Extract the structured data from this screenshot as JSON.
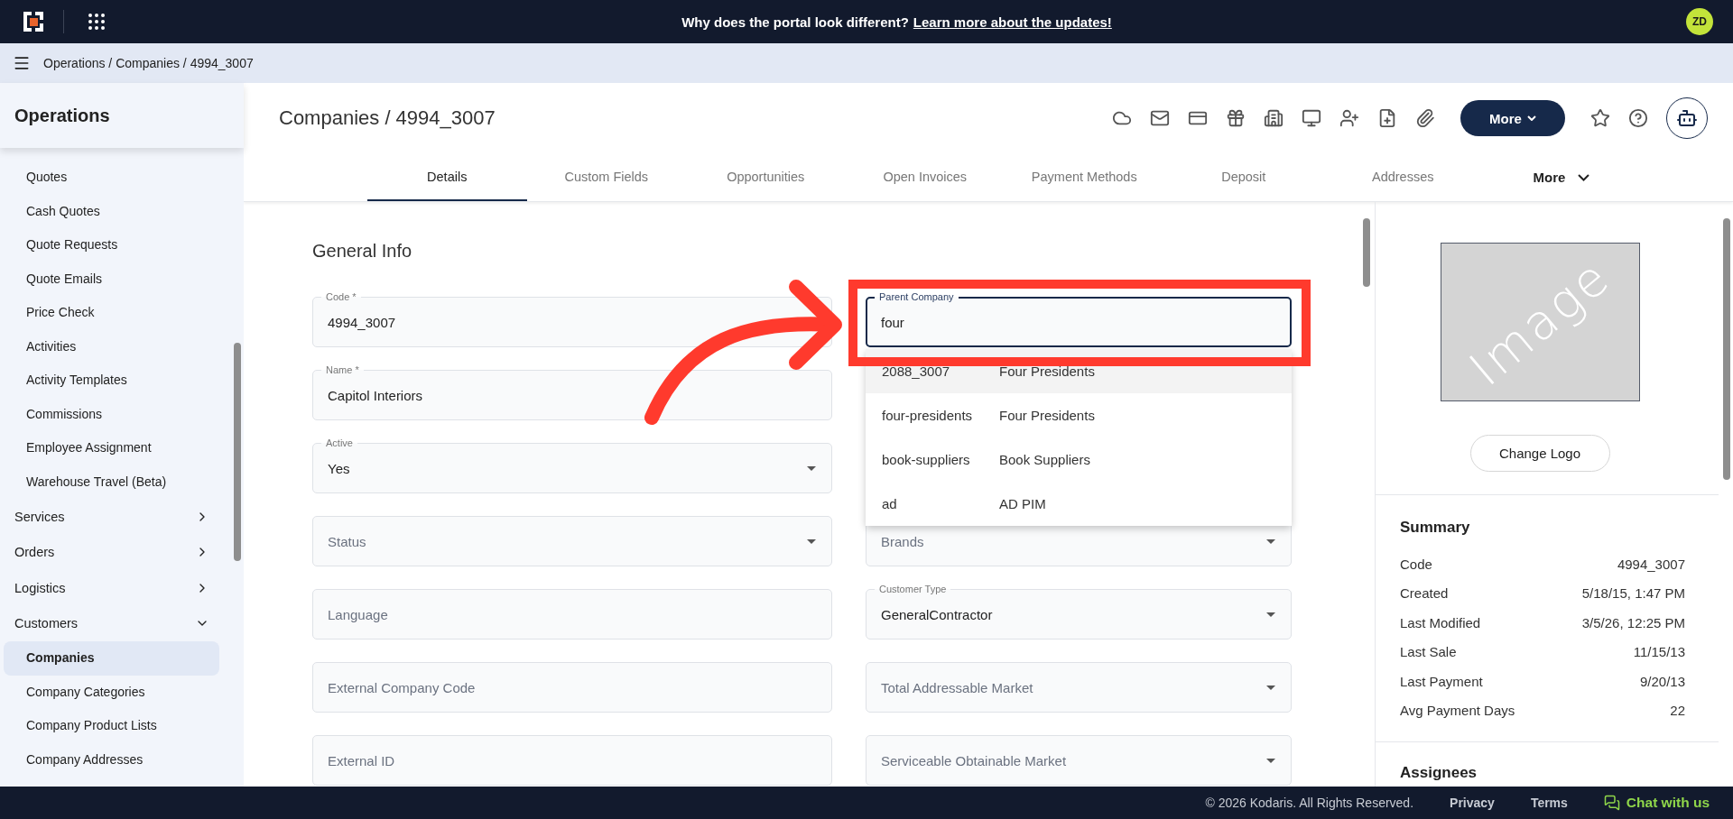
{
  "banner": {
    "text": "Why does the portal look different?",
    "link": "Learn more about the updates!"
  },
  "user": {
    "initials": "ZD"
  },
  "breadcrumb": "Operations / Companies / 4994_3007",
  "sidebar": {
    "title": "Operations",
    "sections": [
      {
        "children": [
          {
            "label": "Quotes",
            "selected": false
          },
          {
            "label": "Cash Quotes",
            "selected": false
          },
          {
            "label": "Quote Requests",
            "selected": false
          },
          {
            "label": "Quote Emails",
            "selected": false
          },
          {
            "label": "Price Check",
            "selected": false
          },
          {
            "label": "Activities",
            "selected": false
          },
          {
            "label": "Activity Templates",
            "selected": false
          },
          {
            "label": "Commissions",
            "selected": false
          },
          {
            "label": "Employee Assignment",
            "selected": false
          },
          {
            "label": "Warehouse Travel (Beta)",
            "selected": false
          }
        ]
      },
      {
        "label": "Services",
        "expanded": false
      },
      {
        "label": "Orders",
        "expanded": false
      },
      {
        "label": "Logistics",
        "expanded": false
      },
      {
        "label": "Customers",
        "expanded": true,
        "children": [
          {
            "label": "Companies",
            "selected": true
          },
          {
            "label": "Company Categories",
            "selected": false
          },
          {
            "label": "Company Product Lists",
            "selected": false
          },
          {
            "label": "Company Addresses",
            "selected": false
          }
        ]
      }
    ]
  },
  "page": {
    "title": "Companies / 4994_3007",
    "more_button": "More"
  },
  "tabs": [
    {
      "label": "Details",
      "selected": true
    },
    {
      "label": "Custom Fields",
      "selected": false
    },
    {
      "label": "Opportunities",
      "selected": false
    },
    {
      "label": "Open Invoices",
      "selected": false
    },
    {
      "label": "Payment Methods",
      "selected": false
    },
    {
      "label": "Deposit",
      "selected": false
    },
    {
      "label": "Addresses",
      "selected": false
    }
  ],
  "tabs_more": "More",
  "general_info": {
    "title": "General Info",
    "left_fields": [
      {
        "kind": "text",
        "label": "Code *",
        "value": "4994_3007"
      },
      {
        "kind": "text",
        "label": "Name *",
        "value": "Capitol Interiors"
      },
      {
        "kind": "select",
        "label": "Active",
        "value": "Yes"
      },
      {
        "kind": "select",
        "placeholder": "Status"
      },
      {
        "kind": "text",
        "placeholder": "Language"
      },
      {
        "kind": "text",
        "placeholder": "External Company Code"
      },
      {
        "kind": "text",
        "placeholder": "External ID"
      }
    ],
    "right_fields": [
      {
        "kind": "text",
        "label": "Parent Company",
        "value": "four",
        "focused": true
      },
      {
        "kind": "select",
        "placeholder": "Brands"
      },
      {
        "kind": "select",
        "label": "Customer Type",
        "value": "GeneralContractor"
      },
      {
        "kind": "select",
        "placeholder": "Total Addressable Market"
      },
      {
        "kind": "select",
        "placeholder": "Serviceable Obtainable Market"
      }
    ]
  },
  "suggestions": [
    {
      "code": "2088_3007",
      "name": "Four Presidents",
      "selected": true
    },
    {
      "code": "four-presidents",
      "name": "Four Presidents",
      "selected": false
    },
    {
      "code": "book-suppliers",
      "name": "Book Suppliers",
      "selected": false
    },
    {
      "code": "ad",
      "name": "AD PIM",
      "selected": false
    }
  ],
  "logo": {
    "placeholder": "Image",
    "button": "Change Logo"
  },
  "summary": {
    "title": "Summary",
    "rows": [
      {
        "label": "Code",
        "value": "4994_3007"
      },
      {
        "label": "Created",
        "value": "5/18/15, 1:47 PM"
      },
      {
        "label": "Last Modified",
        "value": "3/5/26, 12:25 PM"
      },
      {
        "label": "Last Sale",
        "value": "11/15/13"
      },
      {
        "label": "Last Payment",
        "value": "9/20/13"
      },
      {
        "label": "Avg Payment Days",
        "value": "22"
      }
    ]
  },
  "assignees_title": "Assignees",
  "footer": {
    "copyright": "© 2026 Kodaris. All Rights Reserved.",
    "links": [
      "Privacy",
      "Terms"
    ],
    "chat": "Chat with us"
  }
}
